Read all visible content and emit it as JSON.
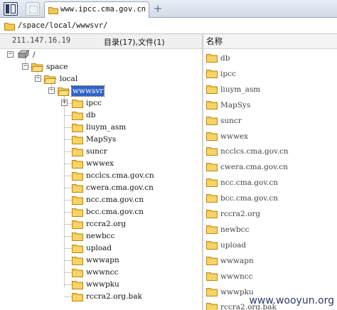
{
  "tabbar": {
    "panel_toggle_icon": "panel-toggle-icon",
    "inactive_button_icon": "blank-window-icon",
    "tab": {
      "label": "www.ipcc.cma.gov.cn",
      "icon": "folder-icon"
    },
    "new_tab_label": "+"
  },
  "path": {
    "value": "/space/local/wwwsvr/",
    "icon": "folder-icon"
  },
  "info": {
    "ip": "211.147.16.19",
    "summary": "目录(17),文件(1)"
  },
  "right_header": {
    "name_column": "名称"
  },
  "tree": {
    "root": "/",
    "space": "space",
    "local": "local",
    "selected": "wwwsvr",
    "children": [
      "ipcc",
      "db",
      "liuym_asm",
      "MapSys",
      "suncr",
      "wwwex",
      "ncclcs.cma.gov.cn",
      "cwera.cma.gov.cn",
      "ncc.cma.gov.cn",
      "bcc.cma.gov.cn",
      "rccra2.org",
      "newbcc",
      "upload",
      "wwwapn",
      "wwwncc",
      "wwwpku",
      "rccra2.org.bak"
    ]
  },
  "right_list": [
    "db",
    "ipcc",
    "liuym_asm",
    "MapSys",
    "suncr",
    "wwwex",
    "ncclcs.cma.gov.cn",
    "cwera.cma.gov.cn",
    "ncc.cma.gov.cn",
    "bcc.cma.gov.cn",
    "rccra2.org",
    "newbcc",
    "upload",
    "wwwapn",
    "wwwncc",
    "wwwpku",
    "rccra2.org.bak"
  ],
  "watermark": "www.wooyun.org",
  "colors": {
    "folder": "#f2c94c",
    "selection": "#2f63c9",
    "tabbar": "#d3dbe7"
  }
}
